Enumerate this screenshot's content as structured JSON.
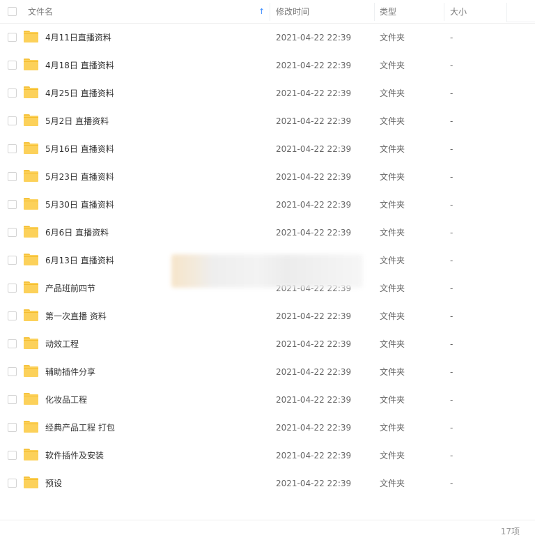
{
  "header": {
    "name": "文件名",
    "modified": "修改时间",
    "type": "类型",
    "size": "大小",
    "sort_indicator": "↑"
  },
  "rows": [
    {
      "name": "4月11日直播资料",
      "date": "2021-04-22 22:39",
      "type": "文件夹",
      "size": "-"
    },
    {
      "name": "4月18日 直播资料",
      "date": "2021-04-22 22:39",
      "type": "文件夹",
      "size": "-"
    },
    {
      "name": "4月25日 直播资料",
      "date": "2021-04-22 22:39",
      "type": "文件夹",
      "size": "-"
    },
    {
      "name": "5月2日 直播资料",
      "date": "2021-04-22 22:39",
      "type": "文件夹",
      "size": "-"
    },
    {
      "name": "5月16日 直播资料",
      "date": "2021-04-22 22:39",
      "type": "文件夹",
      "size": "-"
    },
    {
      "name": "5月23日 直播资料",
      "date": "2021-04-22 22:39",
      "type": "文件夹",
      "size": "-"
    },
    {
      "name": "5月30日 直播资料",
      "date": "2021-04-22 22:39",
      "type": "文件夹",
      "size": "-"
    },
    {
      "name": "6月6日 直播资料",
      "date": "2021-04-22 22:39",
      "type": "文件夹",
      "size": "-"
    },
    {
      "name": "6月13日 直播资料",
      "date": "",
      "type": "文件夹",
      "size": "-"
    },
    {
      "name": "产品班前四节",
      "date": "2021-04-22 22:39",
      "type": "文件夹",
      "size": "-"
    },
    {
      "name": "第一次直播 资料",
      "date": "2021-04-22 22:39",
      "type": "文件夹",
      "size": "-"
    },
    {
      "name": "动效工程",
      "date": "2021-04-22 22:39",
      "type": "文件夹",
      "size": "-"
    },
    {
      "name": "辅助插件分享",
      "date": "2021-04-22 22:39",
      "type": "文件夹",
      "size": "-"
    },
    {
      "name": "化妆品工程",
      "date": "2021-04-22 22:39",
      "type": "文件夹",
      "size": "-"
    },
    {
      "name": "经典产品工程 打包",
      "date": "2021-04-22 22:39",
      "type": "文件夹",
      "size": "-"
    },
    {
      "name": "软件插件及安装",
      "date": "2021-04-22 22:39",
      "type": "文件夹",
      "size": "-"
    },
    {
      "name": "预设",
      "date": "2021-04-22 22:39",
      "type": "文件夹",
      "size": "-"
    }
  ],
  "footer": {
    "count": "17项"
  },
  "icons": {
    "folder": "folder-icon",
    "checkbox": "checkbox",
    "sort": "sort-ascending-icon"
  },
  "colors": {
    "folder": "#fcd15a",
    "sort_arrow": "#3b8cff"
  }
}
